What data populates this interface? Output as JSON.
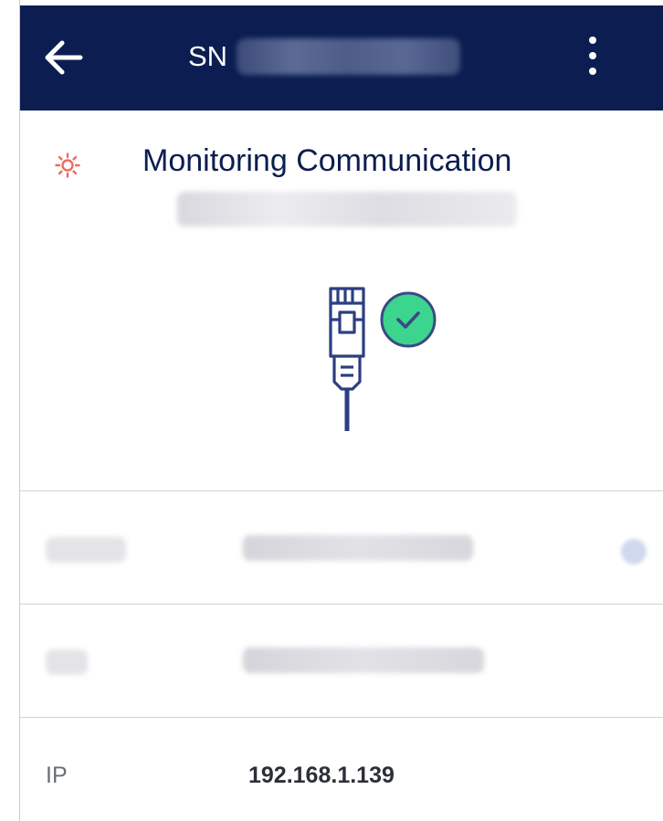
{
  "app_bar": {
    "title_prefix": "SN",
    "serial_redacted": ""
  },
  "header": {
    "title": "Monitoring Communication",
    "subtitle_redacted": ""
  },
  "rows": [
    {
      "label_redacted": "",
      "value_redacted": ""
    },
    {
      "label_redacted": "",
      "value_redacted": ""
    },
    {
      "label": "IP",
      "value": "192.168.1.139"
    }
  ],
  "icons": {
    "back": "arrow-left-icon",
    "menu": "more-vert-icon",
    "status": "sun-icon",
    "connection": "ethernet-cable-icon",
    "connected": "check-circle-icon",
    "info": "info-icon"
  },
  "colors": {
    "app_bar_bg": "#0b1d51",
    "title_text": "#0b1d51",
    "status_icon": "#f06a5e",
    "check_circle": "#3cd58e",
    "check_border": "#3a4a86",
    "cable": "#2c3e83"
  }
}
